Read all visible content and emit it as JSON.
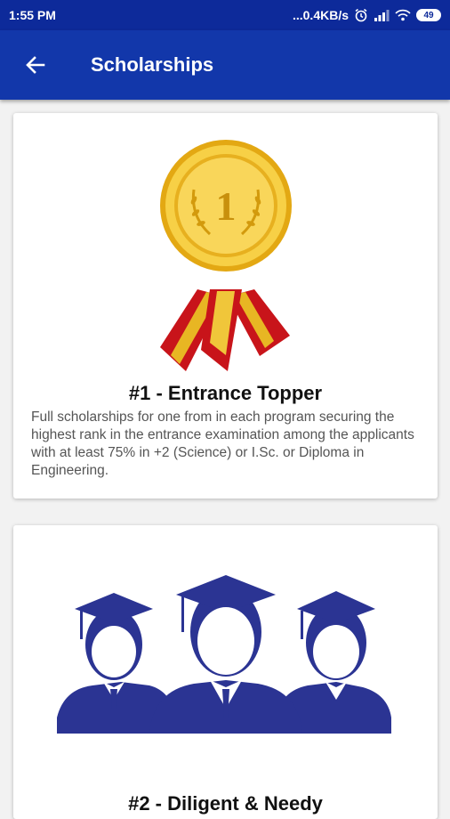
{
  "status_bar": {
    "time": "1:55 PM",
    "network_speed": "...0.4KB/s",
    "battery": "49",
    "icons": [
      "alarm-icon",
      "signal-icon",
      "wifi-icon",
      "battery-icon"
    ]
  },
  "app_bar": {
    "title": "Scholarships",
    "back_icon": "back-arrow-icon",
    "color": "#1237aa"
  },
  "scholarships": [
    {
      "title": "#1 - Entrance Topper",
      "description": "Full scholarships for one from in each program securing the highest rank in the entrance examination among the applicants with at least 75% in +2 (Science) or I.Sc. or Diploma in Engineering.",
      "image": "gold-medal-icon",
      "medal_number": "1"
    },
    {
      "title": "#2 - Diligent & Needy",
      "image": "graduates-icon"
    }
  ]
}
